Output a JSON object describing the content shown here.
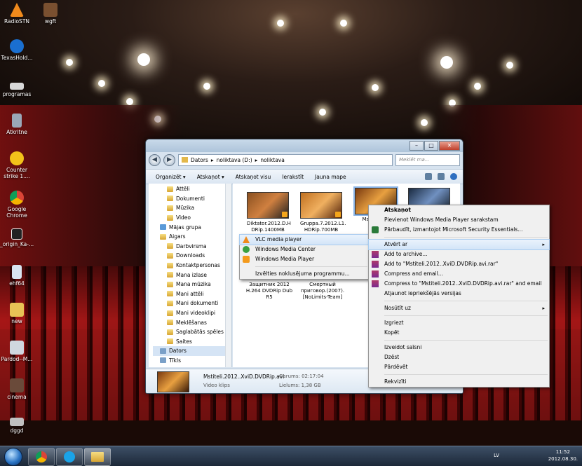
{
  "desktop": {
    "icons": [
      {
        "label": "RadioSTN",
        "color": "#f08a1c"
      },
      {
        "label": "wgft",
        "color": "#7a5030"
      },
      {
        "label": "TexasHold...",
        "color": "#1a6fd0"
      },
      {
        "label": "programas",
        "color": "#d8d8d8"
      },
      {
        "label": "Atkritne",
        "color": "#9aa8b8"
      },
      {
        "label": "Counter strike 1....",
        "color": "#f2c21a"
      },
      {
        "label": "Google Chrome",
        "color": "#3aa757"
      },
      {
        "label": "_origin_Ka-...",
        "color": "#eeeeee"
      },
      {
        "label": "ehf64",
        "color": "#d8e4f0"
      },
      {
        "label": "new",
        "color": "#e8c255"
      },
      {
        "label": "Pardod--M...",
        "color": "#cfd7df"
      },
      {
        "label": "cinema",
        "color": "#6a4a3a"
      },
      {
        "label": "dggd",
        "color": "#c0c0c0"
      }
    ]
  },
  "window": {
    "nav": {
      "back": "◀",
      "forward": "▶"
    },
    "breadcrumb": [
      "Dators",
      "noliktava (D:)",
      "noliktava"
    ],
    "search_placeholder": "Meklēt ma...",
    "controls": {
      "minimize": "–",
      "maximize": "□",
      "close": "✕"
    },
    "toolbar": {
      "organize": "Organizēt ▾",
      "open": "Atskaņot ▾",
      "play_all": "Atskaņot visu",
      "burn": "Ierakstīt",
      "new_folder": "Jauna mape"
    },
    "nav_items": [
      "Attēli",
      "Dokumenti",
      "Mūzika",
      "Video",
      "Mājas grupa",
      "Aigars",
      "Darbvirsma",
      "Downloads",
      "Kontaktpersonas",
      "Mana izlase",
      "Mana mūzika",
      "Mani attēli",
      "Mani dokumenti",
      "Mani videoklipi",
      "Meklēšanas",
      "Saglabātās spēles",
      "Saites",
      "Dators",
      "Tīkls"
    ],
    "files": [
      {
        "name": "Diktator.2012.D.H DRip.1400MB"
      },
      {
        "name": "Gruppa.7.2012.L1. HDRip.700MB"
      },
      {
        "name": "Mstit D.D..."
      },
      {
        "name": "Защитник 2012 H.264 DVDRip Dub R5"
      },
      {
        "name": "Смертный приговор.(2007).[NoLimits-Team]"
      }
    ],
    "details": {
      "filename": "Mstiteli.2012..XviD.DVDRip.avi",
      "type": "Video klips",
      "duration": "Garums: 02:17:04",
      "size": "Lielums: 1,38 GB"
    }
  },
  "context_menu": {
    "items": [
      {
        "label": "Atskaņot",
        "bold": true
      },
      {
        "label": "Pievienot Windows Media Player sarakstam"
      },
      {
        "label": "Pārbaudīt, izmantojot Microsoft Security Essentials..."
      },
      {
        "label": "Atvērt ar",
        "arrow": "▸",
        "highlight": true
      },
      {
        "label": "Add to archive..."
      },
      {
        "label": "Add to \"Mstiteli.2012..XviD.DVDRip.avi.rar\""
      },
      {
        "label": "Compress and email..."
      },
      {
        "label": "Compress to \"Mstiteli.2012..XviD.DVDRip.avi.rar\" and email"
      },
      {
        "label": "Atjaunot iepriekšējās versijas"
      },
      {
        "label": "Nosūtīt uz",
        "arrow": "▸"
      },
      {
        "label": "Izgriezt"
      },
      {
        "label": "Kopēt"
      },
      {
        "label": "Izveidot saīsni"
      },
      {
        "label": "Dzēst"
      },
      {
        "label": "Pārdēvēt"
      },
      {
        "label": "Rekvizīti"
      }
    ]
  },
  "open_with_menu": {
    "items": [
      "VLC media player",
      "Windows Media Center",
      "Windows Media Player",
      "Izvēlties noklusējuma programmu..."
    ]
  },
  "taskbar": {
    "language": "LV",
    "time": "11:52",
    "date": "2012.08.30."
  }
}
